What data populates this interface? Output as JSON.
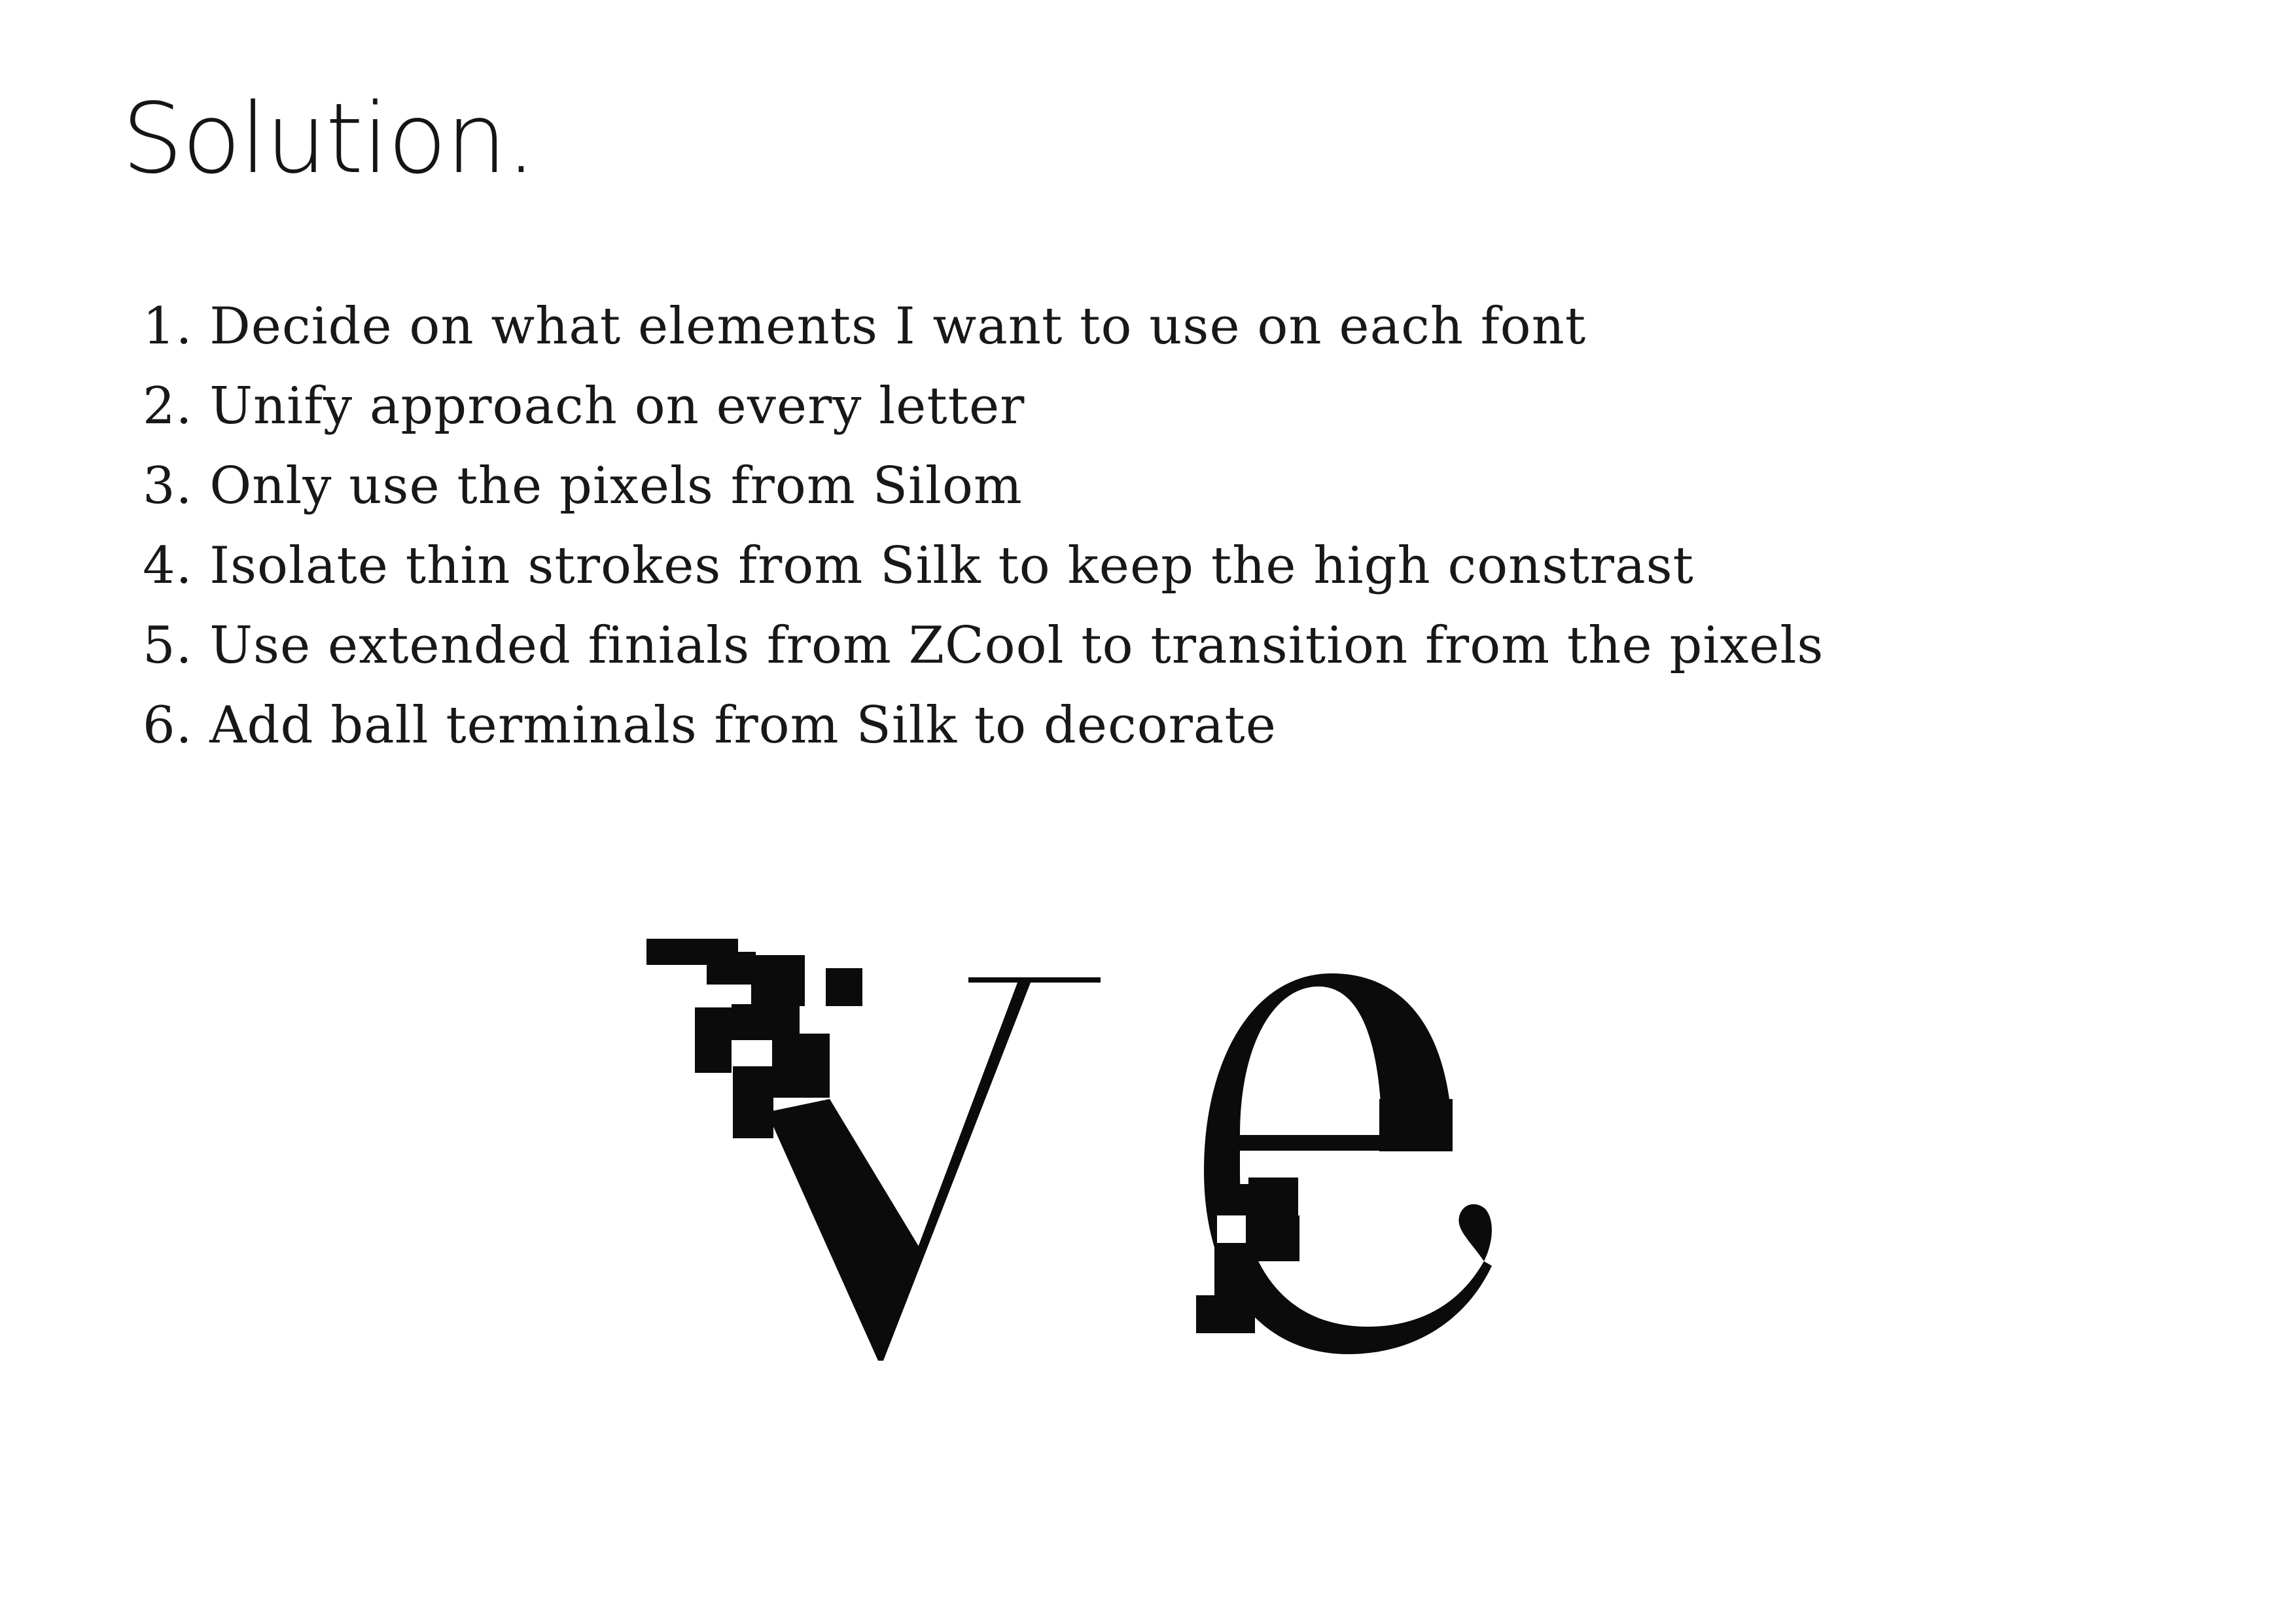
{
  "page": {
    "title": "Solution."
  },
  "steps": [
    "1. Decide on what elements I want to use on each font",
    "2. Unify approach on every letter",
    "3. Only use the pixels from Silom",
    "4. Isolate thin strokes from Silk to keep the high constrast",
    "5. Use extended finials from ZCool to transition from the pixels",
    "6. Add ball terminals from Silk to decorate"
  ],
  "specimen": {
    "glyphs": [
      "v",
      "e"
    ],
    "ink_color": "#0b0b0b"
  }
}
